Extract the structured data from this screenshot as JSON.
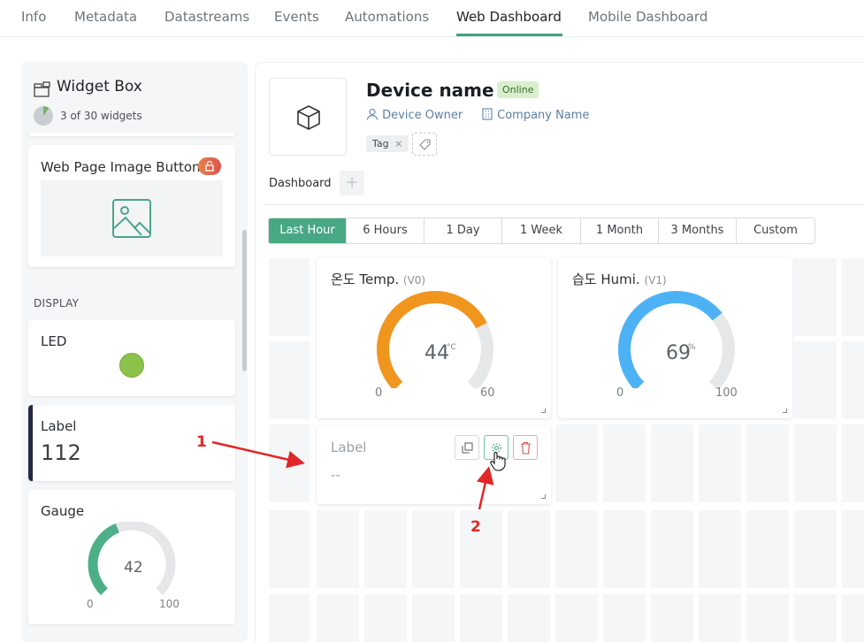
{
  "nav": {
    "tabs": [
      {
        "label": "Info"
      },
      {
        "label": "Metadata"
      },
      {
        "label": "Datastreams"
      },
      {
        "label": "Events"
      },
      {
        "label": "Automations"
      },
      {
        "label": "Web Dashboard",
        "active": true
      },
      {
        "label": "Mobile Dashboard"
      }
    ]
  },
  "sidebar": {
    "title": "Widget Box",
    "count": "3 of 30 widgets",
    "cards": {
      "image_button": {
        "title": "Web Page Image Button"
      },
      "section": "DISPLAY",
      "led": {
        "title": "LED",
        "color": "#8bc34a"
      },
      "label": {
        "title": "Label",
        "value": "112"
      },
      "gauge": {
        "title": "Gauge",
        "value": "42",
        "min": "0",
        "max": "100",
        "fraction": 0.42,
        "color": "#4caf88"
      }
    }
  },
  "device": {
    "name": "Device name",
    "status": "Online",
    "owner": "Device Owner",
    "company": "Company Name",
    "tag": "Tag",
    "dashboard_tab": "Dashboard"
  },
  "time_ranges": [
    "Last Hour",
    "6 Hours",
    "1 Day",
    "1 Week",
    "1 Month",
    "3 Months",
    "Custom"
  ],
  "time_range_selected": "Last Hour",
  "widgets": {
    "temp": {
      "title": "온도 Temp.",
      "pin": "(V0)",
      "value": "44",
      "unit": "°C",
      "min": "0",
      "max": "60",
      "fraction": 0.733,
      "color": "#f0961e"
    },
    "humi": {
      "title": "습도 Humi.",
      "pin": "(V1)",
      "value": "69",
      "unit": "%",
      "min": "0",
      "max": "100",
      "fraction": 0.69,
      "color": "#4db2f5"
    },
    "label": {
      "title": "Label",
      "value": "--"
    }
  },
  "annotations": {
    "one": "1",
    "two": "2"
  },
  "colors": {
    "accent": "#48a883",
    "annotation": "#e12727"
  }
}
